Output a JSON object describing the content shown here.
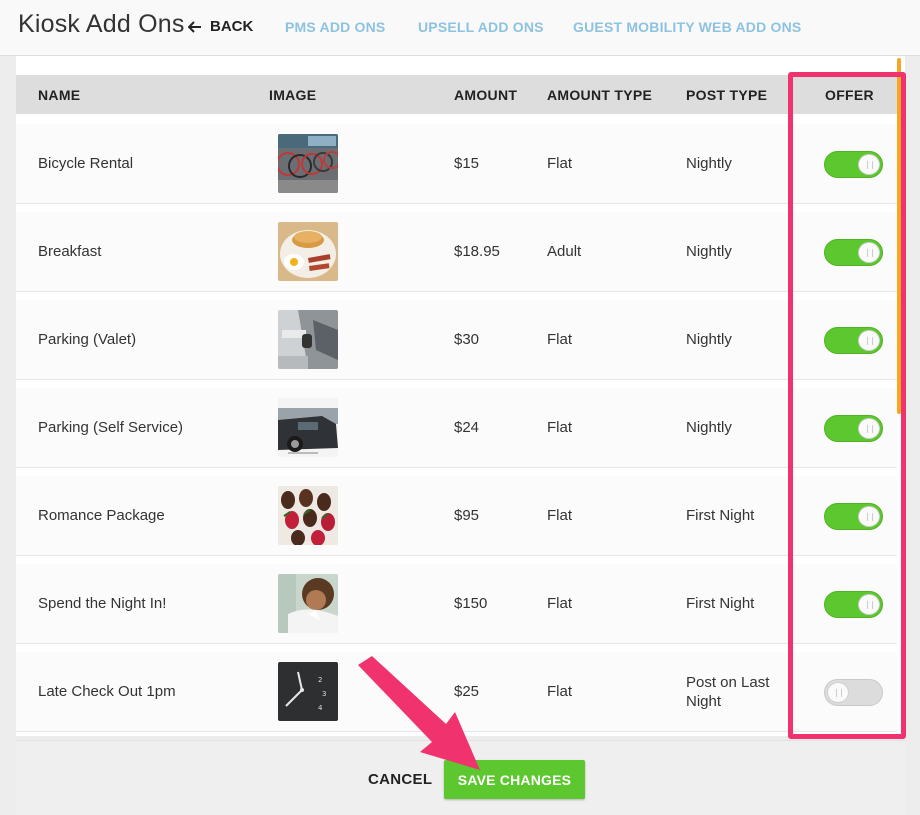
{
  "header": {
    "title": "Kiosk Add Ons",
    "back_label": "BACK",
    "tabs": [
      {
        "label": "PMS ADD ONS"
      },
      {
        "label": "UPSELL ADD ONS"
      },
      {
        "label": "GUEST MOBILITY WEB ADD ONS"
      }
    ]
  },
  "table": {
    "columns": [
      "NAME",
      "IMAGE",
      "AMOUNT",
      "AMOUNT TYPE",
      "POST TYPE",
      "OFFER"
    ],
    "rows": [
      {
        "name": "Bicycle Rental",
        "image": "bicycles-photo",
        "amount": "$15",
        "amount_type": "Flat",
        "post_type": "Nightly",
        "offer": true
      },
      {
        "name": "Breakfast",
        "image": "breakfast-photo",
        "amount": "$18.95",
        "amount_type": "Adult",
        "post_type": "Nightly",
        "offer": true
      },
      {
        "name": "Parking (Valet)",
        "image": "valet-photo",
        "amount": "$30",
        "amount_type": "Flat",
        "post_type": "Nightly",
        "offer": true
      },
      {
        "name": "Parking (Self Service)",
        "image": "parked-cars-photo",
        "amount": "$24",
        "amount_type": "Flat",
        "post_type": "Nightly",
        "offer": true
      },
      {
        "name": "Romance Package",
        "image": "chocolate-strawberries-photo",
        "amount": "$95",
        "amount_type": "Flat",
        "post_type": "First Night",
        "offer": true
      },
      {
        "name": "Spend the Night In!",
        "image": "woman-in-bed-photo",
        "amount": "$150",
        "amount_type": "Flat",
        "post_type": "First Night",
        "offer": true
      },
      {
        "name": "Late Check Out 1pm",
        "image": "clock-photo",
        "amount": "$25",
        "amount_type": "Flat",
        "post_type": "Post on Last Night",
        "offer": false
      }
    ]
  },
  "footer": {
    "cancel_label": "CANCEL",
    "save_label": "SAVE CHANGES"
  },
  "colors": {
    "accent_green": "#5cc72e",
    "tab_blue": "#8dc3e0",
    "highlight_pink": "#f0336e",
    "scroll_orange": "#f5a623"
  }
}
